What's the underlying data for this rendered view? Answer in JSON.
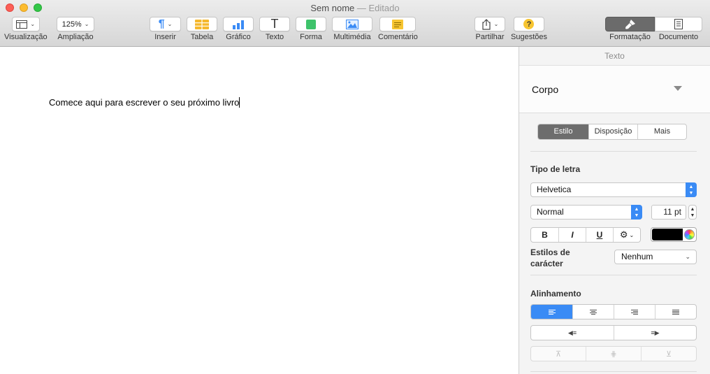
{
  "window": {
    "title": "Sem nome",
    "title_sep": "—",
    "status": "Editado"
  },
  "toolbar": {
    "view": "Visualização",
    "zoom_value": "125%",
    "zoom": "Ampliação",
    "insert": "Inserir",
    "table": "Tabela",
    "chart": "Gráfico",
    "text_glyph": "T",
    "text": "Texto",
    "shape": "Forma",
    "media": "Multimédia",
    "comment": "Comentário",
    "share": "Partilhar",
    "tips_glyph": "?",
    "tips": "Sugestões",
    "format": "Formatação",
    "document": "Documento"
  },
  "document": {
    "body_text": "Comece aqui para escrever o seu próximo livro"
  },
  "inspector": {
    "header": "Texto",
    "paragraph_style": "Corpo",
    "tabs": [
      "Estilo",
      "Disposição",
      "Mais"
    ],
    "active_tab": "Estilo",
    "font_section": "Tipo de letra",
    "font_family": "Helvetica",
    "font_typeface": "Normal",
    "font_size": "11 pt",
    "bold": "B",
    "italic": "I",
    "underline": "U",
    "text_color": "#000000",
    "char_styles_label_1": "Estilos de",
    "char_styles_label_2": "carácter",
    "char_styles_value": "Nenhum",
    "alignment_section": "Alinhamento",
    "alignment_selected": "left"
  },
  "colors": {
    "accent": "#3a8bf5",
    "table_icon": "#f5b82e",
    "chart_icon": "#3a8bf5",
    "shape_icon": "#3ec36b",
    "comment_icon": "#f7c531",
    "tips_icon": "#f7c531"
  }
}
